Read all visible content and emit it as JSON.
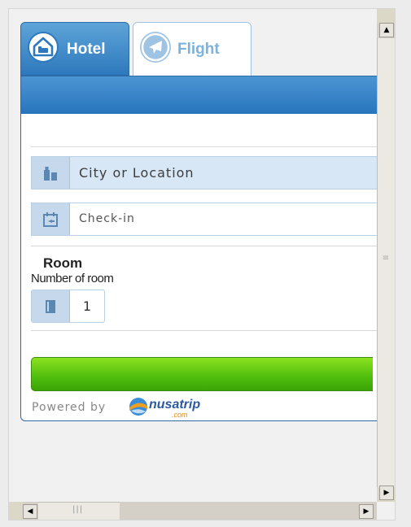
{
  "tabs": [
    {
      "label": "Hotel",
      "icon": "hotel-icon",
      "active": true
    },
    {
      "label": "Flight",
      "icon": "airplane-icon",
      "active": false
    }
  ],
  "form": {
    "city_placeholder": "City or Location",
    "checkin_placeholder": "Check-in",
    "room_title": "Room",
    "room_subtitle": "Number of room",
    "room_value": "1"
  },
  "footer": {
    "powered_by": "Powered by",
    "brand_name": "nusatrip",
    "brand_domain": ".com"
  },
  "colors": {
    "accent_blue": "#2e79bd",
    "search_green": "#4fbd0c",
    "field_highlight": "#d7e7f6"
  }
}
